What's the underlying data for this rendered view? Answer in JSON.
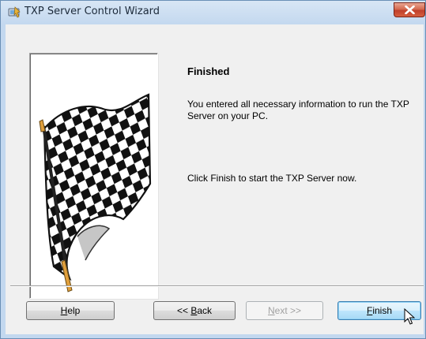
{
  "window": {
    "title": "TXP Server Control Wizard",
    "icon": "wizard-app-icon",
    "close_icon": "close-icon"
  },
  "banner": {
    "image": "checkered-flag-image"
  },
  "content": {
    "heading": "Finished",
    "paragraph1": "You entered all necessary information to run the TXP Server on your PC.",
    "paragraph2": "Click Finish to start the TXP Server now."
  },
  "buttons": {
    "help": {
      "mnemonic": "H",
      "rest": "elp"
    },
    "back": {
      "prefix": "<< ",
      "mnemonic": "B",
      "rest": "ack"
    },
    "next": {
      "mnemonic": "N",
      "rest": "ext >>",
      "enabled": false
    },
    "finish": {
      "mnemonic": "F",
      "rest": "inish",
      "default": true
    }
  },
  "colors": {
    "dialog_bg": "#f0f0f0",
    "title_bar": "#c3d8ef",
    "close_button": "#c0402a",
    "default_button_border": "#3c7fb1"
  }
}
